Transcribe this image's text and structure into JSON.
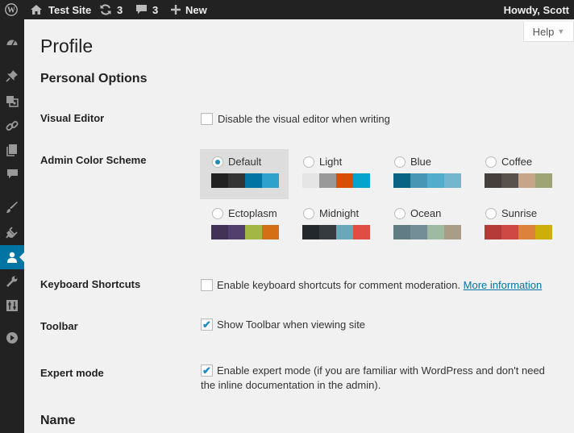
{
  "adminbar": {
    "site_name": "Test Site",
    "updates_count": "3",
    "comments_count": "3",
    "new_label": "New",
    "howdy": "Howdy, Scott"
  },
  "sidebar": {
    "icons": [
      "dashboard-icon",
      "pin-icon",
      "media-icon",
      "links-icon",
      "pages-icon",
      "comments-icon",
      "appearance-icon",
      "plugins-icon",
      "users-icon",
      "tools-icon",
      "settings-icon",
      "collapse-icon"
    ],
    "current": "users-icon"
  },
  "help_label": "Help",
  "page_title": "Profile",
  "personal_options_heading": "Personal Options",
  "visual_editor": {
    "label": "Visual Editor",
    "option": "Disable the visual editor when writing",
    "checked": false
  },
  "color_scheme": {
    "label": "Admin Color Scheme",
    "selected": "Default",
    "schemes": [
      {
        "name": "Default",
        "colors": [
          "#222222",
          "#333333",
          "#0074a2",
          "#2ea2cc"
        ]
      },
      {
        "name": "Light",
        "colors": [
          "#e5e5e5",
          "#999999",
          "#d64e07",
          "#04a4cc"
        ]
      },
      {
        "name": "Blue",
        "colors": [
          "#096484",
          "#4796b3",
          "#52accc",
          "#74b6ce"
        ]
      },
      {
        "name": "Coffee",
        "colors": [
          "#46403c",
          "#59524c",
          "#c7a589",
          "#9ea476"
        ]
      },
      {
        "name": "Ectoplasm",
        "colors": [
          "#413256",
          "#523f6d",
          "#a3b745",
          "#d46f15"
        ]
      },
      {
        "name": "Midnight",
        "colors": [
          "#25282b",
          "#363b3f",
          "#69a8bb",
          "#e14d43"
        ]
      },
      {
        "name": "Ocean",
        "colors": [
          "#627c83",
          "#738e96",
          "#9ebaa0",
          "#aa9d88"
        ]
      },
      {
        "name": "Sunrise",
        "colors": [
          "#b43c38",
          "#cf4944",
          "#dd823b",
          "#ccaf0b"
        ]
      }
    ]
  },
  "keyboard_shortcuts": {
    "label": "Keyboard Shortcuts",
    "option": "Enable keyboard shortcuts for comment moderation.",
    "link": "More information",
    "checked": false
  },
  "toolbar_opt": {
    "label": "Toolbar",
    "option": "Show Toolbar when viewing site",
    "checked": true
  },
  "expert_mode": {
    "label": "Expert mode",
    "option_line1": "Enable expert mode (if you are familiar with WordPress and don't need",
    "option_line2": "the inline documentation in the admin).",
    "checked": true
  },
  "name_heading": "Name"
}
